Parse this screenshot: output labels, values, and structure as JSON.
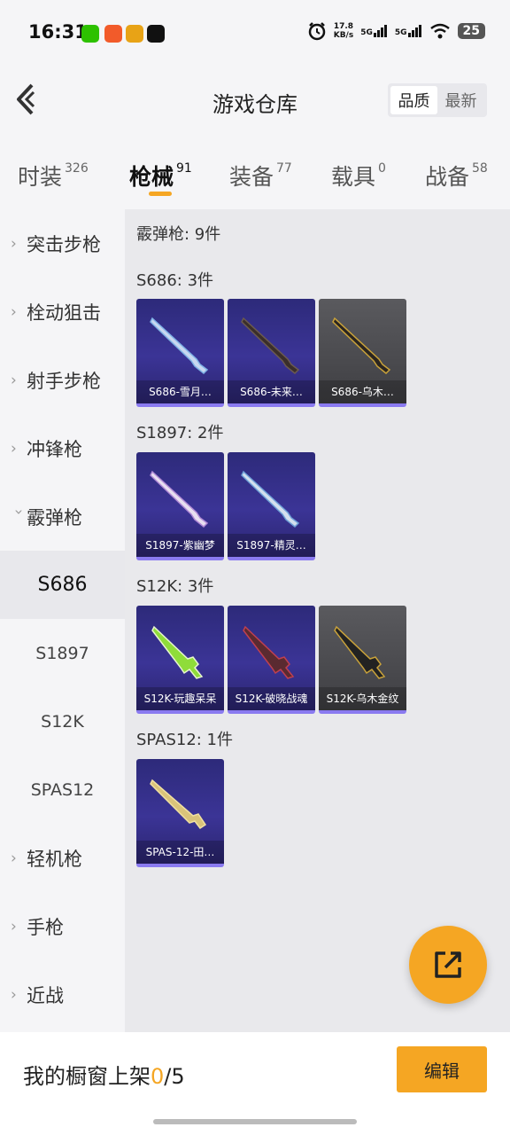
{
  "status_bar": {
    "time": "16:31",
    "net_speed_value": "17.8",
    "net_speed_unit": "KB/s",
    "signal1": "5G",
    "signal2": "5G",
    "battery": "25",
    "icons": [
      "alarm-icon",
      "wifi-icon",
      "signal-icon"
    ],
    "app_icon_colors": [
      "#2dc100",
      "#f25b2a",
      "#e8a316",
      "#111111"
    ]
  },
  "header": {
    "title": "游戏仓库",
    "sort_options": [
      "品质",
      "最新"
    ],
    "active_sort": "品质"
  },
  "categories": [
    {
      "label": "时装",
      "count": "326"
    },
    {
      "label": "枪械",
      "count": "91",
      "active": true
    },
    {
      "label": "装备",
      "count": "77"
    },
    {
      "label": "载具",
      "count": "0"
    },
    {
      "label": "战备",
      "count": "58"
    }
  ],
  "sidebar": {
    "items": [
      {
        "label": "突击步枪",
        "type": "parent"
      },
      {
        "label": "栓动狙击",
        "type": "parent"
      },
      {
        "label": "射手步枪",
        "type": "parent"
      },
      {
        "label": "冲锋枪",
        "type": "parent"
      },
      {
        "label": "霰弹枪",
        "type": "parent",
        "expanded": true
      },
      {
        "label": "S686",
        "type": "sub",
        "active": true
      },
      {
        "label": "S1897",
        "type": "sub"
      },
      {
        "label": "S12K",
        "type": "sub"
      },
      {
        "label": "SPAS12",
        "type": "sub"
      },
      {
        "label": "轻机枪",
        "type": "parent"
      },
      {
        "label": "手枪",
        "type": "parent"
      },
      {
        "label": "近战",
        "type": "parent"
      }
    ]
  },
  "main": {
    "category_title": "霰弹枪: 9件",
    "sections": [
      {
        "title": "S686: 3件",
        "items": [
          {
            "name": "S686-雪月…",
            "bg": "purple"
          },
          {
            "name": "S686-未来…",
            "bg": "purple"
          },
          {
            "name": "S686-乌木…",
            "bg": "grey"
          }
        ]
      },
      {
        "title": "S1897: 2件",
        "items": [
          {
            "name": "S1897-紫幽梦",
            "bg": "purple"
          },
          {
            "name": "S1897-精灵…",
            "bg": "purple"
          }
        ]
      },
      {
        "title": "S12K: 3件",
        "items": [
          {
            "name": "S12K-玩趣呆呆",
            "bg": "purple"
          },
          {
            "name": "S12K-破晓战魂",
            "bg": "purple"
          },
          {
            "name": "S12K-乌木金纹",
            "bg": "grey"
          }
        ]
      },
      {
        "title": "SPAS12: 1件",
        "items": [
          {
            "name": "SPAS-12-田…",
            "bg": "purple"
          }
        ]
      }
    ]
  },
  "fab": {
    "icon": "share-icon"
  },
  "bottom": {
    "showcase_label": "我的橱窗上架",
    "showcase_current": "0",
    "showcase_total": "/5",
    "edit_label": "编辑"
  },
  "colors": {
    "accent": "#f5a623",
    "card_purple": "#3b3496",
    "card_grey": "#4a4a4e"
  }
}
